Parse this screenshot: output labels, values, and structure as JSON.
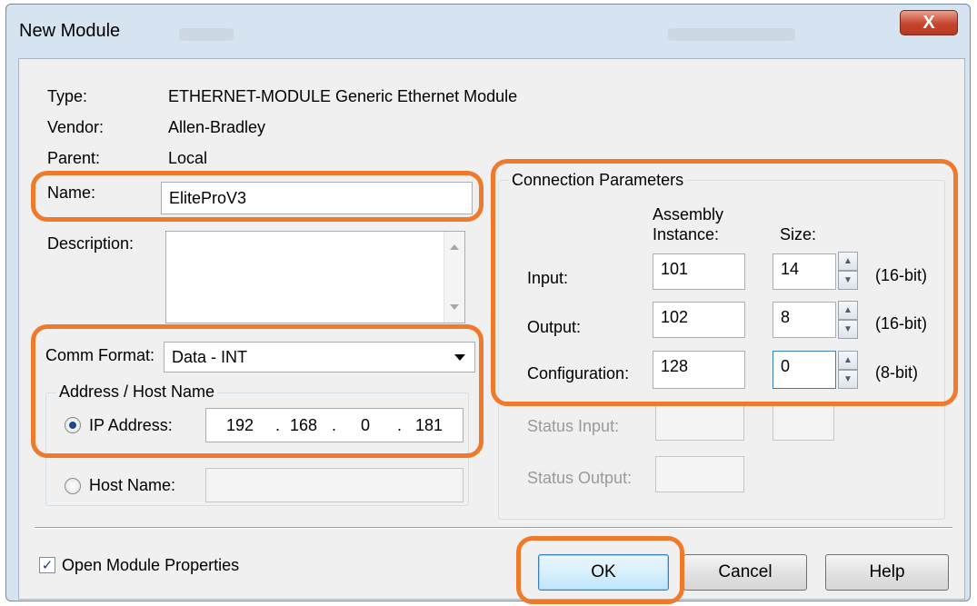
{
  "window": {
    "title": "New Module",
    "close_glyph": "X"
  },
  "info": {
    "type_label": "Type:",
    "type_value": "ETHERNET-MODULE Generic Ethernet Module",
    "vendor_label": "Vendor:",
    "vendor_value": "Allen-Bradley",
    "parent_label": "Parent:",
    "parent_value": "Local"
  },
  "name": {
    "label": "Name:",
    "value": "EliteProV3"
  },
  "description": {
    "label": "Description:",
    "value": ""
  },
  "comm_format": {
    "label": "Comm Format:",
    "value": "Data - INT"
  },
  "address": {
    "group_title": "Address / Host Name",
    "ip_label": "IP Address:",
    "ip_octets": [
      "192",
      "168",
      "0",
      "181"
    ],
    "ip_dot": ".",
    "host_label": "Host Name:",
    "host_value": "",
    "selected": "ip"
  },
  "connection": {
    "title": "Connection Parameters",
    "col_assembly_line1": "Assembly",
    "col_assembly_line2": "Instance:",
    "col_size": "Size:",
    "rows": [
      {
        "label": "Input:",
        "instance": "101",
        "size": "14",
        "unit": "(16-bit)"
      },
      {
        "label": "Output:",
        "instance": "102",
        "size": "8",
        "unit": "(16-bit)"
      },
      {
        "label": "Configuration:",
        "instance": "128",
        "size": "0",
        "unit": "(8-bit)"
      }
    ],
    "status_input_label": "Status Input:",
    "status_output_label": "Status Output:"
  },
  "open_props": {
    "label": "Open Module Properties",
    "checked": true
  },
  "buttons": {
    "ok": "OK",
    "cancel": "Cancel",
    "help": "Help"
  },
  "colors": {
    "highlight": "#f07a2c",
    "window_frame": "#d6e3f1",
    "client": "#f0f0f0"
  }
}
